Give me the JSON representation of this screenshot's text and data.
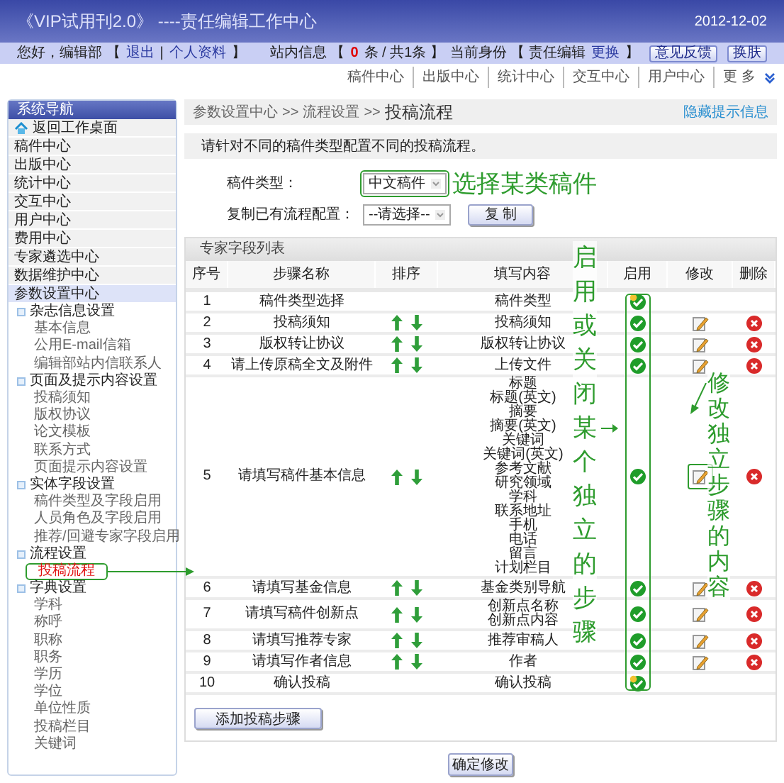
{
  "window": {
    "title": "《VIP试用刊2.0》 ----责任编辑工作中心",
    "date": "2012-12-02"
  },
  "user_bar": {
    "left": [
      {
        "kind": "text",
        "text": "您好，编辑部 【"
      },
      {
        "kind": "link",
        "text": "退出"
      },
      {
        "kind": "text",
        "text": "|"
      },
      {
        "kind": "link",
        "text": "个人资料"
      },
      {
        "kind": "text",
        "text": "】"
      }
    ],
    "right": [
      {
        "kind": "text",
        "text": "站内信息 【"
      },
      {
        "kind": "count",
        "text": "0"
      },
      {
        "kind": "text",
        "text": "条 / 共1条 】"
      },
      {
        "kind": "text",
        "text": "当前身份 【 责任编辑"
      },
      {
        "kind": "link",
        "text": "更换"
      },
      {
        "kind": "text",
        "text": "】"
      }
    ],
    "buttons": [
      "意见反馈",
      "换肤"
    ]
  },
  "nav_links": [
    "稿件中心",
    "出版中心",
    "统计中心",
    "交互中心",
    "用户中心",
    "更 多"
  ],
  "sidebar": {
    "title": "系统导航",
    "items": [
      {
        "label": "返回工作桌面",
        "kind": "home",
        "selected": false
      },
      {
        "label": "稿件中心",
        "selected": false
      },
      {
        "label": "出版中心",
        "selected": false
      },
      {
        "label": "统计中心",
        "selected": false
      },
      {
        "label": "交互中心",
        "selected": false
      },
      {
        "label": "用户中心",
        "selected": false
      },
      {
        "label": "费用中心",
        "selected": false
      },
      {
        "label": "专家遴选中心",
        "selected": false
      },
      {
        "label": "数据维护中心",
        "selected": false
      },
      {
        "label": "参数设置中心",
        "selected": true,
        "children": [
          {
            "label": "杂志信息设置",
            "children": [
              {
                "label": "基本信息",
                "selected": false
              },
              {
                "label": "公用E-mail信箱",
                "selected": false
              },
              {
                "label": "编辑部站内信联系人",
                "selected": false
              }
            ]
          },
          {
            "label": "页面及提示内容设置",
            "children": [
              {
                "label": "投稿须知",
                "selected": false
              },
              {
                "label": "版权协议",
                "selected": false
              },
              {
                "label": "论文模板",
                "selected": false
              },
              {
                "label": "联系方式",
                "selected": false
              },
              {
                "label": "页面提示内容设置",
                "selected": false
              }
            ]
          },
          {
            "label": "实体字段设置",
            "children": [
              {
                "label": "稿件类型及字段启用",
                "selected": false
              },
              {
                "label": "人员角色及字段启用",
                "selected": false
              },
              {
                "label": "推荐/回避专家字段启用",
                "selected": false
              }
            ]
          },
          {
            "label": "流程设置",
            "children": [
              {
                "label": "投稿流程",
                "selected": true
              }
            ]
          },
          {
            "label": "字典设置",
            "children": [
              {
                "label": "学科",
                "selected": false
              },
              {
                "label": "称呼",
                "selected": false
              },
              {
                "label": "职称",
                "selected": false
              },
              {
                "label": "职务",
                "selected": false
              },
              {
                "label": "学历",
                "selected": false
              },
              {
                "label": "学位",
                "selected": false
              },
              {
                "label": "单位性质",
                "selected": false
              },
              {
                "label": "投稿栏目",
                "selected": false
              },
              {
                "label": "关键词",
                "selected": false
              }
            ]
          }
        ]
      }
    ]
  },
  "breadcrumb": [
    "参数设置中心",
    ">>",
    "流程设置",
    ">>",
    "投稿流程"
  ],
  "hide_tips_link": "隐藏提示信息",
  "notice": "请针对不同的稿件类型配置不同的投稿流程。",
  "form": {
    "type_label": "稿件类型：",
    "type_value": "中文稿件",
    "copy_label": "复制已有流程配置：",
    "copy_value": "--请选择--",
    "copy_button": "复 制"
  },
  "table": {
    "title": "专家字段列表",
    "columns": [
      "序号",
      "步骤名称",
      "排序",
      "填写内容",
      "启用",
      "修改",
      "删除"
    ],
    "rows": [
      {
        "no": "1",
        "name": "稿件类型选择",
        "kind": "fixed",
        "content": [
          "稿件类型"
        ],
        "enabled": true
      },
      {
        "no": "2",
        "name": "投稿须知",
        "kind": "step",
        "content": [
          "投稿须知"
        ],
        "enabled": true
      },
      {
        "no": "3",
        "name": "版权转让协议",
        "kind": "step",
        "content": [
          "版权转让协议"
        ],
        "enabled": true
      },
      {
        "no": "4",
        "name": "请上传原稿全文及附件",
        "kind": "step",
        "content": [
          "上传文件"
        ],
        "enabled": true
      },
      {
        "no": "5",
        "name": "请填写稿件基本信息",
        "kind": "step",
        "content": [
          "标题",
          "标题(英文)",
          "摘要",
          "摘要(英文)",
          "关键词",
          "关键词(英文)",
          "参考文献",
          "研究领域",
          "学科",
          "联系地址",
          "手机",
          "电话",
          "留言",
          "计划栏目"
        ],
        "enabled": true
      },
      {
        "no": "6",
        "name": "请填写基金信息",
        "kind": "step",
        "content": [
          "基金类别导航"
        ],
        "enabled": true
      },
      {
        "no": "7",
        "name": "请填写稿件创新点",
        "kind": "step",
        "content": [
          "创新点名称",
          "创新点内容"
        ],
        "enabled": true
      },
      {
        "no": "8",
        "name": "请填写推荐专家",
        "kind": "step",
        "content": [
          "推荐审稿人"
        ],
        "enabled": true
      },
      {
        "no": "9",
        "name": "请填写作者信息",
        "kind": "step",
        "content": [
          "作者"
        ],
        "enabled": true
      },
      {
        "no": "10",
        "name": "确认投稿",
        "kind": "fixed",
        "content": [
          "确认投稿"
        ],
        "enabled": true
      }
    ]
  },
  "add_button": "添加投稿步骤",
  "confirm_button": "确定修改",
  "annotations": [
    {
      "kind": "label",
      "text": "选择某类稿件"
    },
    {
      "kind": "vertical",
      "text": "启用或关闭某个独立的步骤"
    },
    {
      "kind": "vertical",
      "text": "修改独立步骤的内容"
    }
  ]
}
